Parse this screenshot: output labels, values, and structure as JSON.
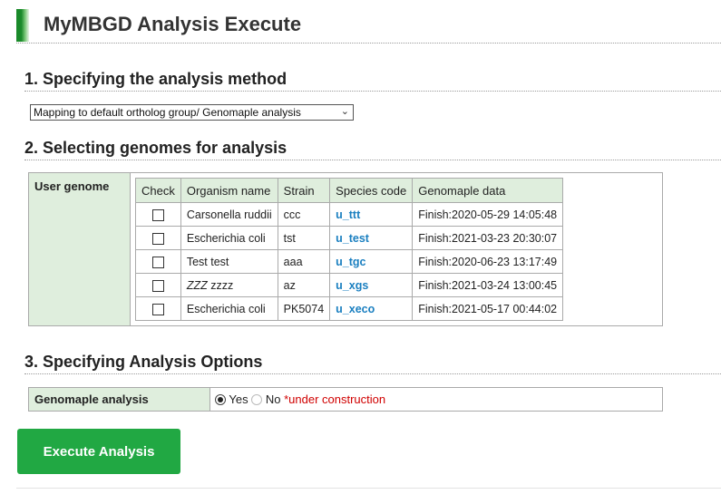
{
  "header": {
    "title": "MyMBGD Analysis Execute"
  },
  "section1": {
    "heading": "1. Specifying the analysis method",
    "select_value": "Mapping to default ortholog group/ Genomaple analysis"
  },
  "section2": {
    "heading": "2. Selecting genomes for analysis",
    "row_label": "User genome",
    "columns": [
      "Check",
      "Organism name",
      "Strain",
      "Species code",
      "Genomaple data"
    ],
    "rows": [
      {
        "organism": "Carsonella ruddii",
        "strain": "ccc",
        "code": "u_ttt",
        "data": "Finish:2020-05-29 14:05:48"
      },
      {
        "organism": "Escherichia coli",
        "strain": "tst",
        "code": "u_test",
        "data": "Finish:2021-03-23 20:30:07"
      },
      {
        "organism": "Test test",
        "strain": "aaa",
        "code": "u_tgc",
        "data": "Finish:2020-06-23 13:17:49"
      },
      {
        "organism_italic": "ZZZ",
        "organism_rest": " zzzz",
        "strain": "az",
        "code": "u_xgs",
        "data": "Finish:2021-03-24 13:00:45"
      },
      {
        "organism": "Escherichia coli",
        "strain": "PK5074",
        "code": "u_xeco",
        "data": "Finish:2021-05-17 00:44:02"
      }
    ]
  },
  "section3": {
    "heading": "3. Specifying Analysis Options",
    "option_label": "Genomaple analysis",
    "yes_label": "Yes",
    "no_label": "No",
    "note": "*under construction"
  },
  "execute_label": "Execute Analysis",
  "icons": {
    "select_chevron": "chevron-down-icon"
  }
}
